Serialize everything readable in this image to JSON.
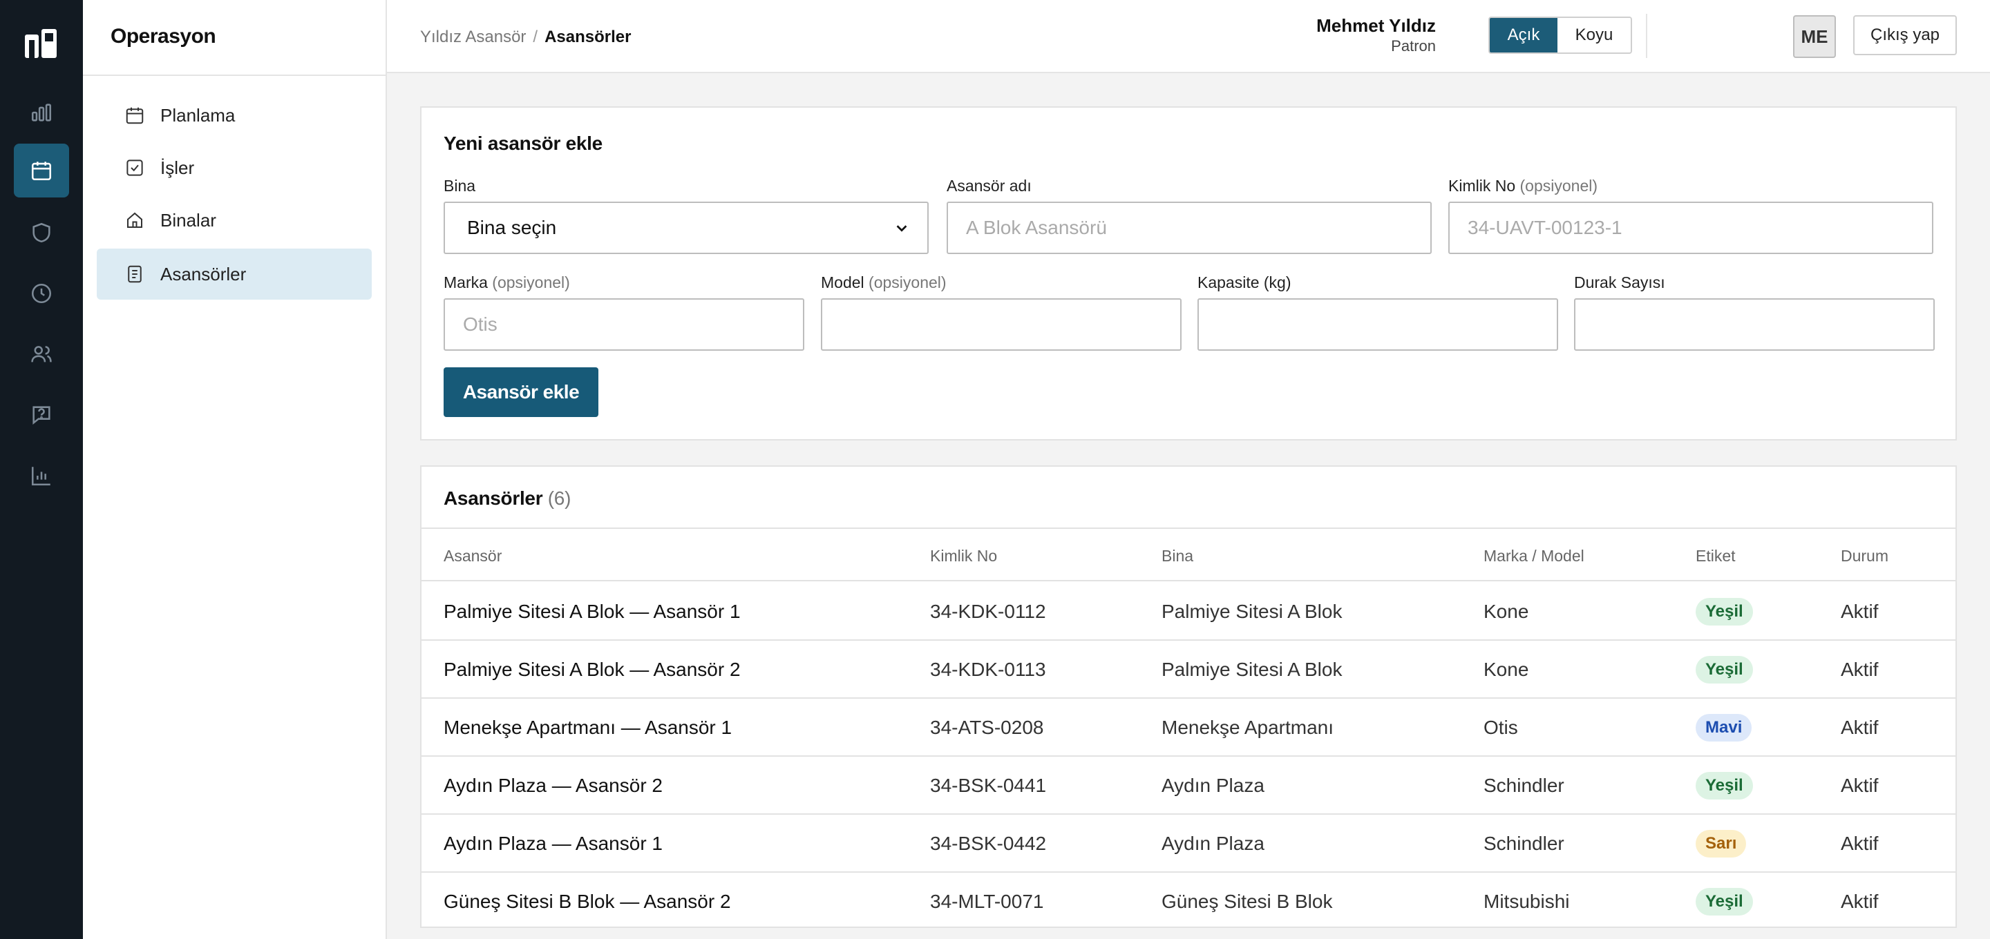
{
  "app": {
    "rail": [
      {
        "icon": "chart-bar-icon"
      },
      {
        "icon": "calendar-icon",
        "active": true
      },
      {
        "icon": "shield-icon"
      },
      {
        "icon": "clock-icon"
      },
      {
        "icon": "users-icon"
      },
      {
        "icon": "help-icon"
      },
      {
        "icon": "analytics-icon"
      }
    ]
  },
  "sidebar": {
    "title": "Operasyon",
    "items": [
      {
        "label": "Planlama",
        "icon": "calendar-icon"
      },
      {
        "label": "İşler",
        "icon": "checkbox-icon"
      },
      {
        "label": "Binalar",
        "icon": "home-icon"
      },
      {
        "label": "Asansörler",
        "icon": "document-icon",
        "active": true
      }
    ]
  },
  "header": {
    "breadcrumb": {
      "root": "Yıldız Asansör",
      "separator": "/",
      "current": "Asansörler"
    },
    "theme": {
      "light": "Açık",
      "dark": "Koyu",
      "selected": "Açık"
    },
    "user": {
      "name": "Mehmet Yıldız",
      "role": "Patron",
      "initials": "ME"
    },
    "logout": "Çıkış yap"
  },
  "form": {
    "title": "Yeni asansör ekle",
    "building": {
      "label": "Bina",
      "value": "Bina seçin"
    },
    "name": {
      "label": "Asansör adı",
      "placeholder": "A Blok Asansörü"
    },
    "id_no": {
      "label": "Kimlik No",
      "optional": "(opsiyonel)",
      "placeholder": "34-UAVT-00123-1"
    },
    "brand": {
      "label": "Marka",
      "optional": "(opsiyonel)",
      "placeholder": "Otis"
    },
    "model": {
      "label": "Model",
      "optional": "(opsiyonel)",
      "placeholder": ""
    },
    "capacity": {
      "label": "Kapasite (kg)",
      "placeholder": ""
    },
    "stops": {
      "label": "Durak Sayısı",
      "placeholder": ""
    },
    "submit": "Asansör ekle"
  },
  "table": {
    "title": "Asansörler",
    "count": "(6)",
    "columns": [
      "Asansör",
      "Kimlik No",
      "Bina",
      "Marka / Model",
      "Etiket",
      "Durum"
    ],
    "rows": [
      {
        "name": "Palmiye Sitesi A Blok — Asansör 1",
        "id": "34-KDK-0112",
        "building": "Palmiye Sitesi A Blok",
        "brand": "Kone",
        "tag": "Yeşil",
        "status": "Aktif"
      },
      {
        "name": "Palmiye Sitesi A Blok — Asansör 2",
        "id": "34-KDK-0113",
        "building": "Palmiye Sitesi A Blok",
        "brand": "Kone",
        "tag": "Yeşil",
        "status": "Aktif"
      },
      {
        "name": "Menekşe Apartmanı — Asansör 1",
        "id": "34-ATS-0208",
        "building": "Menekşe Apartmanı",
        "brand": "Otis",
        "tag": "Mavi",
        "status": "Aktif"
      },
      {
        "name": "Aydın Plaza — Asansör 2",
        "id": "34-BSK-0441",
        "building": "Aydın Plaza",
        "brand": "Schindler",
        "tag": "Yeşil",
        "status": "Aktif"
      },
      {
        "name": "Aydın Plaza — Asansör 1",
        "id": "34-BSK-0442",
        "building": "Aydın Plaza",
        "brand": "Schindler",
        "tag": "Sarı",
        "status": "Aktif"
      },
      {
        "name": "Güneş Sitesi B Blok — Asansör 2",
        "id": "34-MLT-0071",
        "building": "Güneş Sitesi B Blok",
        "brand": "Mitsubishi",
        "tag": "Yeşil",
        "status": "Aktif"
      }
    ]
  },
  "colors": {
    "rail": "#121a22",
    "accent": "#1c5c78",
    "active_nav": "#dcebf3"
  }
}
